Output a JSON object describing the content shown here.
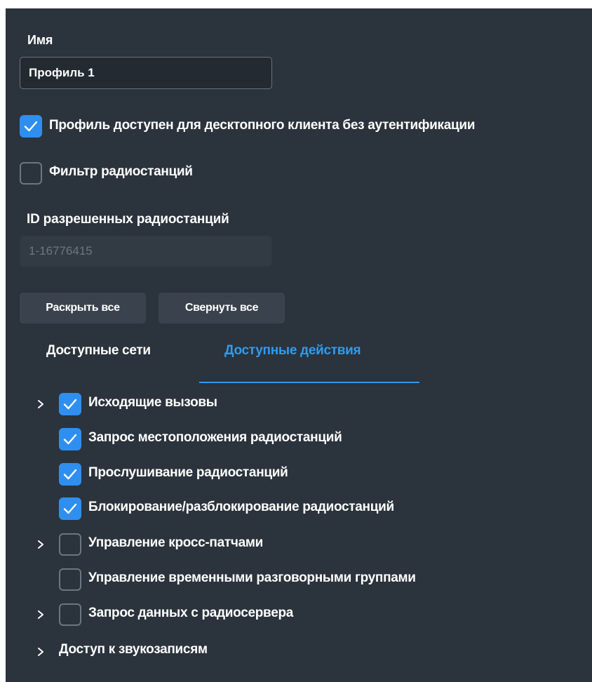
{
  "form": {
    "name_label": "Имя",
    "name_value": "Профиль 1",
    "desktop_access_label": "Профиль доступен для десктопного клиента без аутентификации",
    "desktop_access_checked": true,
    "radio_filter_label": "Фильтр радиостанций",
    "radio_filter_checked": false,
    "allowed_ids_label": "ID разрешенных радиостанций",
    "allowed_ids_placeholder": "1-16776415"
  },
  "buttons": {
    "expand_all": "Раскрыть все",
    "collapse_all": "Свернуть все"
  },
  "tabs": [
    {
      "label": "Доступные сети",
      "active": false
    },
    {
      "label": "Доступные действия",
      "active": true
    }
  ],
  "tree": [
    {
      "label": "Исходящие вызовы",
      "checked": true,
      "expandable": true,
      "has_checkbox": true
    },
    {
      "label": "Запрос местоположения радиостанций",
      "checked": true,
      "expandable": false,
      "has_checkbox": true
    },
    {
      "label": "Прослушивание радиостанций",
      "checked": true,
      "expandable": false,
      "has_checkbox": true
    },
    {
      "label": "Блокирование/разблокирование радиостанций",
      "checked": true,
      "expandable": false,
      "has_checkbox": true
    },
    {
      "label": "Управление кросс-патчами",
      "checked": false,
      "expandable": true,
      "has_checkbox": true
    },
    {
      "label": "Управление временными разговорными группами",
      "checked": false,
      "expandable": false,
      "has_checkbox": true
    },
    {
      "label": "Запрос данных с радиосервера",
      "checked": false,
      "expandable": true,
      "has_checkbox": true
    },
    {
      "label": "Доступ к звукозаписям",
      "checked": false,
      "expandable": true,
      "has_checkbox": false
    }
  ],
  "colors": {
    "panel_bg": "#2b333c",
    "accent": "#2f8ff0",
    "text": "#ffffff"
  },
  "icons": {
    "check": "check-icon",
    "chevron": "chevron-right-icon"
  }
}
